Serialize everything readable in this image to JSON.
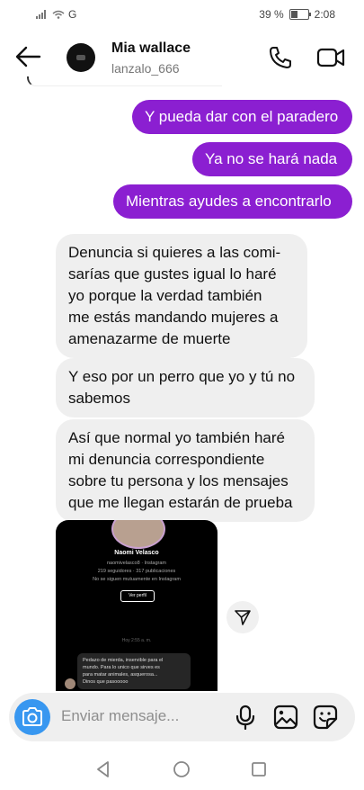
{
  "status_bar": {
    "network": "G",
    "battery": "39 %",
    "time": "2:08"
  },
  "header": {
    "name": "Mia wallace",
    "username": "lanzalo_666"
  },
  "messages": [
    {
      "from": "me",
      "text": "Y pueda dar con el paradero"
    },
    {
      "from": "me",
      "text": "Ya no se hará nada"
    },
    {
      "from": "me",
      "text": "Mientras ayudes a encontrarlo"
    },
    {
      "from": "them",
      "lines": [
        "Denuncia si quieres a las comi-",
        "sarías que gustes igual lo haré",
        "yo porque la verdad también",
        "me estás mandando mujeres a",
        "amenazarme de muerte"
      ]
    },
    {
      "from": "them",
      "lines": [
        "Y eso por un perro que yo y tú no",
        "sabemos"
      ]
    },
    {
      "from": "them",
      "lines": [
        "Así que normal yo también haré",
        "mi denuncia correspondiente",
        "sobre tu persona y los mensajes",
        "que me llegan estarán de prueba"
      ]
    }
  ],
  "shared_post": {
    "name": "Naomi Velasco",
    "handle": "naomivelasco8 · Instagram",
    "stats": "219 seguidores · 317 publicaciones",
    "follow_note": "No se siguen mutuamente en Instagram",
    "button": "Ver perfil",
    "time": "Hoy 2:55 a. m.",
    "message_lines": [
      "Pedazo de mierda, inservible para el",
      "mundo. Para lo unico que sirves es",
      "para matar animales, asquerosa...",
      "Dinos que pasooooo"
    ]
  },
  "composer": {
    "placeholder": "Enviar mensaje..."
  },
  "icons": {
    "back": "arrow-left-icon",
    "call": "phone-icon",
    "video": "video-camera-icon",
    "camera": "camera-icon",
    "mic": "microphone-icon",
    "gallery": "image-icon",
    "sticker": "sticker-icon",
    "share": "paper-plane-icon"
  },
  "colors": {
    "outgoing_bubble": "#8b1fd1",
    "incoming_bubble": "#efefef",
    "camera_button": "#3897f0"
  }
}
